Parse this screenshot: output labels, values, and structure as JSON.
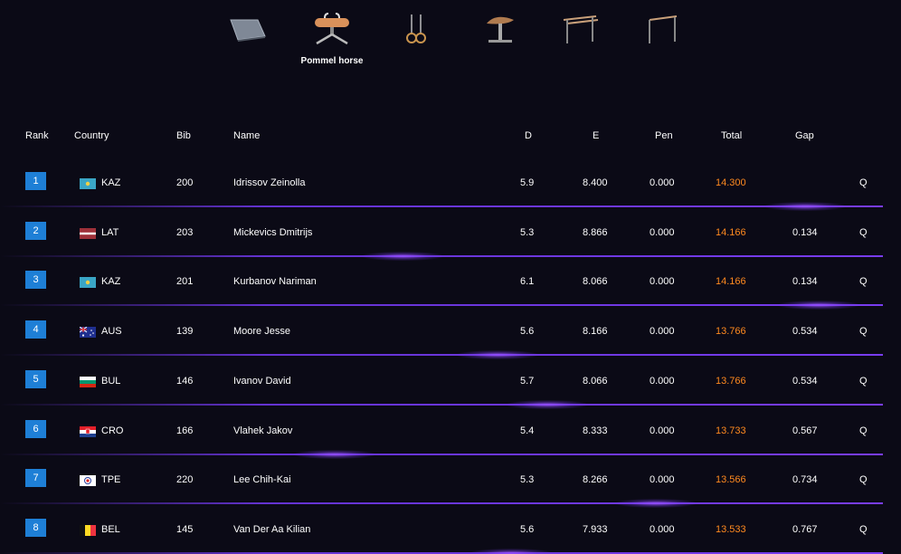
{
  "apparatus": {
    "selected_label": "Pommel horse",
    "items": [
      {
        "icon": "floor-icon"
      },
      {
        "icon": "pommel-horse-icon",
        "label": "Pommel horse"
      },
      {
        "icon": "rings-icon"
      },
      {
        "icon": "vault-icon"
      },
      {
        "icon": "parallel-bars-icon"
      },
      {
        "icon": "high-bar-icon"
      }
    ]
  },
  "table": {
    "headers": {
      "rank": "Rank",
      "country": "Country",
      "bib": "Bib",
      "name": "Name",
      "d": "D",
      "e": "E",
      "pen": "Pen",
      "total": "Total",
      "gap": "Gap"
    },
    "rows": [
      {
        "rank": "1",
        "country": "KAZ",
        "bib": "200",
        "name": "Idrissov Zeinolla",
        "d": "5.9",
        "e": "8.400",
        "pen": "0.000",
        "total": "14.300",
        "gap": "",
        "q": "Q"
      },
      {
        "rank": "2",
        "country": "LAT",
        "bib": "203",
        "name": "Mickevics Dmitrijs",
        "d": "5.3",
        "e": "8.866",
        "pen": "0.000",
        "total": "14.166",
        "gap": "0.134",
        "q": "Q"
      },
      {
        "rank": "3",
        "country": "KAZ",
        "bib": "201",
        "name": "Kurbanov Nariman",
        "d": "6.1",
        "e": "8.066",
        "pen": "0.000",
        "total": "14.166",
        "gap": "0.134",
        "q": "Q"
      },
      {
        "rank": "4",
        "country": "AUS",
        "bib": "139",
        "name": "Moore Jesse",
        "d": "5.6",
        "e": "8.166",
        "pen": "0.000",
        "total": "13.766",
        "gap": "0.534",
        "q": "Q"
      },
      {
        "rank": "5",
        "country": "BUL",
        "bib": "146",
        "name": "Ivanov David",
        "d": "5.7",
        "e": "8.066",
        "pen": "0.000",
        "total": "13.766",
        "gap": "0.534",
        "q": "Q"
      },
      {
        "rank": "6",
        "country": "CRO",
        "bib": "166",
        "name": "Vlahek Jakov",
        "d": "5.4",
        "e": "8.333",
        "pen": "0.000",
        "total": "13.733",
        "gap": "0.567",
        "q": "Q"
      },
      {
        "rank": "7",
        "country": "TPE",
        "bib": "220",
        "name": "Lee Chih-Kai",
        "d": "5.3",
        "e": "8.266",
        "pen": "0.000",
        "total": "13.566",
        "gap": "0.734",
        "q": "Q"
      },
      {
        "rank": "8",
        "country": "BEL",
        "bib": "145",
        "name": "Van Der Aa Kilian",
        "d": "5.6",
        "e": "7.933",
        "pen": "0.000",
        "total": "13.533",
        "gap": "0.767",
        "q": "Q"
      }
    ]
  },
  "colors": {
    "background": "#0b0a16",
    "rank_badge": "#1e7fd6",
    "total_text": "#ff8a1f",
    "separator": "#7a3cf0"
  }
}
